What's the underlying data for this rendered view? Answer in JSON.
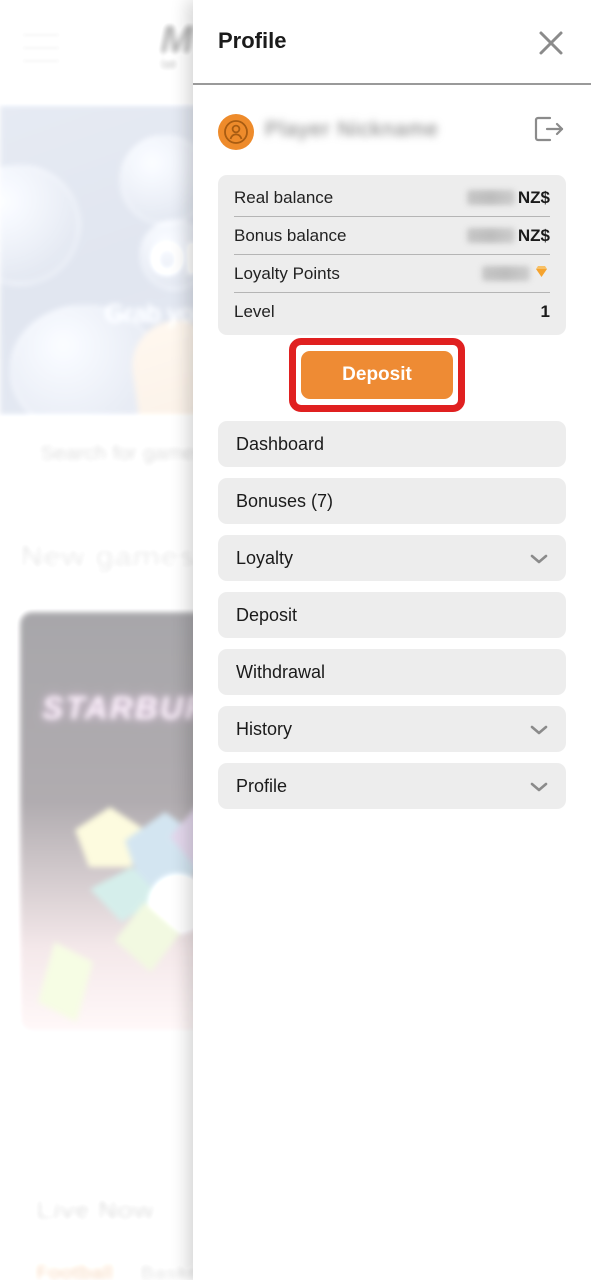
{
  "background": {
    "logo": "M",
    "logo_sub": "bet",
    "banner_title": "OFFER",
    "banner_subtitle": "Grab your bonus",
    "search_placeholder": "Search for games",
    "new_games_heading": "New games",
    "game_card_title": "STARBURST",
    "live_now_heading": "Live Now",
    "sport_tabs": [
      "Football",
      "Basketball"
    ]
  },
  "drawer": {
    "title": "Profile",
    "close_icon": "close-icon",
    "user": {
      "avatar_icon": "user-avatar-icon",
      "name": "",
      "logout_icon": "logout-icon"
    },
    "balances": [
      {
        "label": "Real balance",
        "value": "",
        "suffix": "NZ$",
        "redacted": true,
        "icon": ""
      },
      {
        "label": "Bonus balance",
        "value": "",
        "suffix": "NZ$",
        "redacted": true,
        "icon": ""
      },
      {
        "label": "Loyalty Points",
        "value": "",
        "suffix": "",
        "redacted": true,
        "icon": "diamond-icon"
      },
      {
        "label": "Level",
        "value": "1",
        "suffix": "",
        "redacted": false,
        "icon": ""
      }
    ],
    "deposit_button": {
      "label": "Deposit",
      "color": "#ee8b34",
      "highlight_color": "#e02020",
      "highlighted": true
    },
    "menu": [
      {
        "label": "Dashboard",
        "chevron": false
      },
      {
        "label": "Bonuses (7)",
        "chevron": false
      },
      {
        "label": "Loyalty",
        "chevron": true
      },
      {
        "label": "Deposit",
        "chevron": false
      },
      {
        "label": "Withdrawal",
        "chevron": false
      },
      {
        "label": "History",
        "chevron": true
      },
      {
        "label": "Profile",
        "chevron": true
      }
    ]
  },
  "colors": {
    "accent": "#ee8b34",
    "highlight": "#e02020",
    "panel_bg": "#ffffff",
    "item_bg": "#ededed",
    "text": "#1b1b1b"
  }
}
